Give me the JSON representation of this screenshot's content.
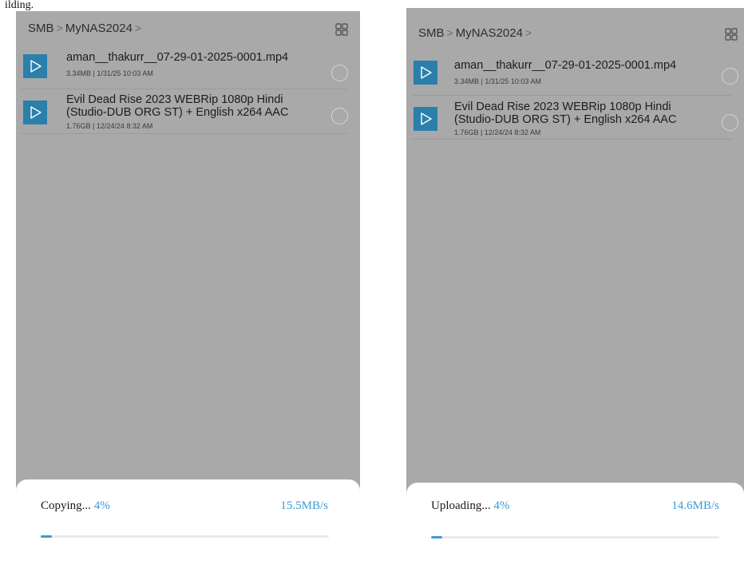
{
  "caption": "ilding.",
  "screens": [
    {
      "breadcrumb": {
        "root": "SMB",
        "sep1": ">",
        "folder": "MyNAS2024",
        "sep2": ">"
      },
      "files": [
        {
          "name": "aman__thakurr__07-29-01-2025-0001.mp4",
          "size": "3.34MB",
          "date": "1/31/25 10:03 AM",
          "meta": "3.34MB  |  1/31/25 10:03 AM"
        },
        {
          "name_line1": "Evil Dead Rise 2023 WEBRip 1080p Hindi",
          "name_line2": "(Studio-DUB ORG ST) + English x264 AAC",
          "size": "1.76GB",
          "date": "12/24/24 8:32 AM",
          "meta": "1.76GB  |  12/24/24 8:32 AM"
        }
      ],
      "progress": {
        "label": "Copying... ",
        "percent_text": "4%",
        "speed": "15.5MB/s",
        "fraction": 0.04
      }
    },
    {
      "breadcrumb": {
        "root": "SMB",
        "sep1": ">",
        "folder": "MyNAS2024",
        "sep2": ">"
      },
      "files": [
        {
          "name": "aman__thakurr__07-29-01-2025-0001.mp4",
          "size": "3.34MB",
          "date": "1/31/25 10:03 AM",
          "meta": "3.34MB  |  1/31/25 10:03 AM"
        },
        {
          "name_line1": "Evil Dead Rise 2023 WEBRip 1080p Hindi",
          "name_line2": "(Studio-DUB ORG ST) + English x264 AAC",
          "size": "1.76GB",
          "date": "12/24/24 8:32 AM",
          "meta": "1.76GB  |  12/24/24 8:32 AM"
        }
      ],
      "progress": {
        "label": "Uploading... ",
        "percent_text": "4%",
        "speed": "14.6MB/s",
        "fraction": 0.04
      }
    }
  ],
  "icons": {
    "view_toggle": "grid-view-icon",
    "thumbnail": "play-icon",
    "select": "select-circle-icon"
  },
  "colors": {
    "background": "#a9a9a9",
    "thumbnail": "#2a7fab",
    "accent": "#3a9bd4"
  }
}
